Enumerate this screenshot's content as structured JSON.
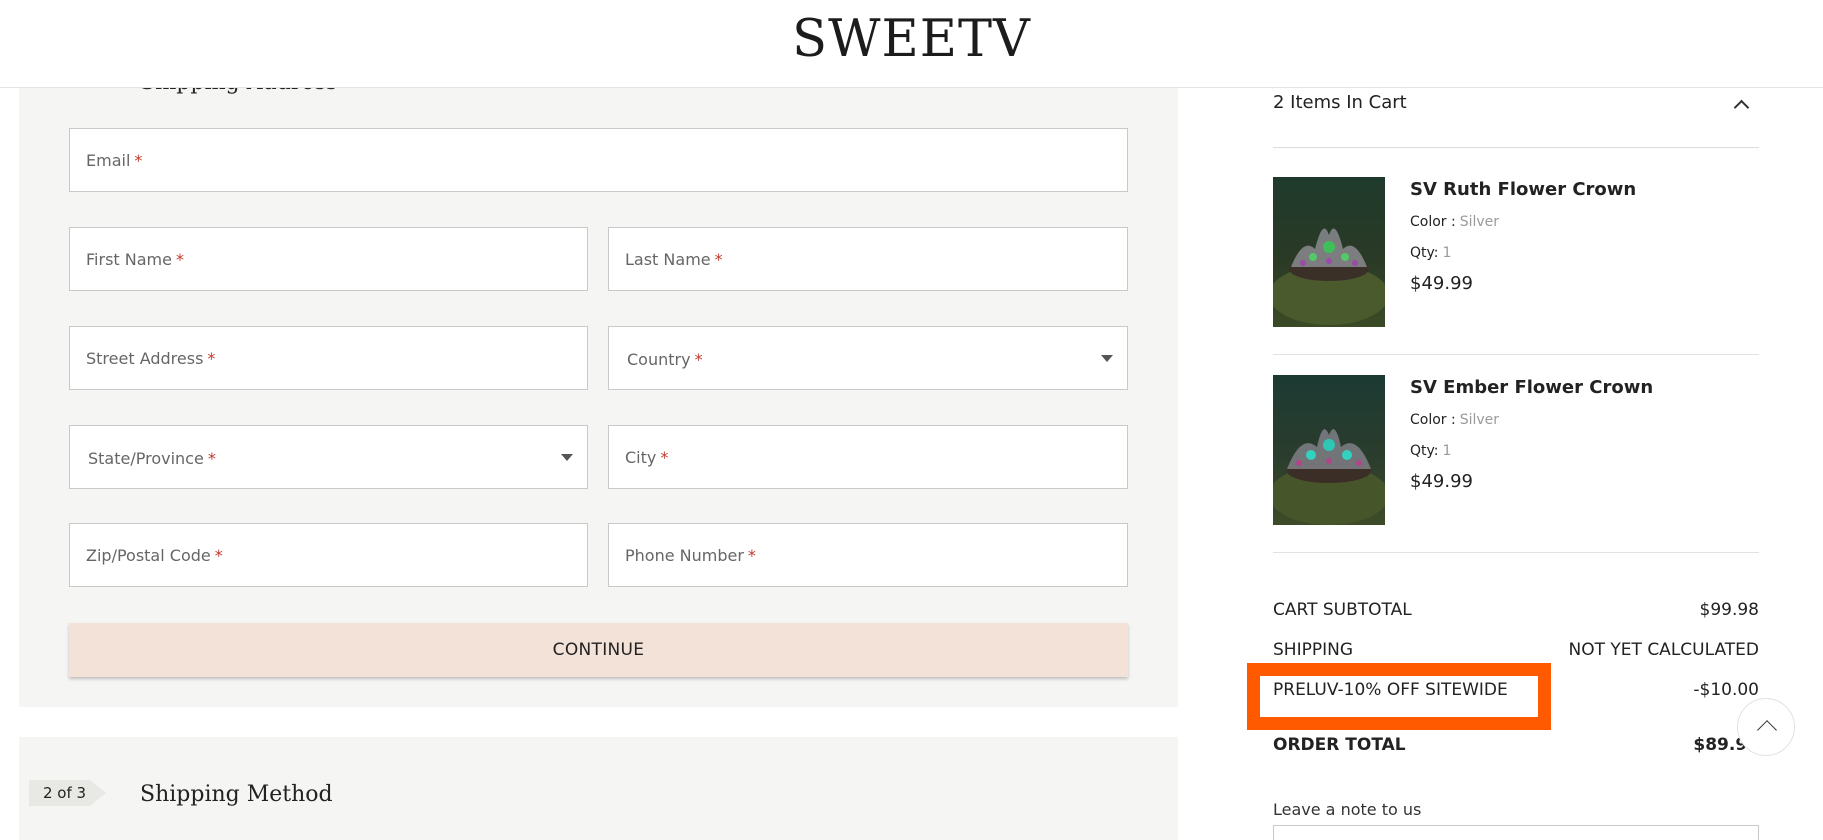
{
  "brand": {
    "logo": "SWEETV"
  },
  "checkout": {
    "step1": {
      "badge": "",
      "title": "Shipping Address"
    },
    "step2": {
      "badge": "2 of 3",
      "title": "Shipping Method"
    },
    "fields": {
      "email": "Email",
      "first_name": "First Name",
      "last_name": "Last Name",
      "street": "Street Address",
      "country": "Country",
      "state": "State/Province",
      "city": "City",
      "zip": "Zip/Postal Code",
      "phone": "Phone Number",
      "required_mark": "*"
    },
    "continue_label": "CONTINUE"
  },
  "cart": {
    "count_label": "2 Items In Cart",
    "items": [
      {
        "name": "SV Ruth Flower Crown",
        "color_label": "Color :",
        "color": "Silver",
        "qty_label": "Qty:",
        "qty": "1",
        "price": "$49.99"
      },
      {
        "name": "SV Ember Flower Crown",
        "color_label": "Color :",
        "color": "Silver",
        "qty_label": "Qty:",
        "qty": "1",
        "price": "$49.99"
      }
    ],
    "summary": {
      "subtotal_label": "CART SUBTOTAL",
      "subtotal": "$99.98",
      "shipping_label": "SHIPPING",
      "shipping": "NOT YET CALCULATED",
      "discount_label": "PRELUV-10% OFF SITEWIDE",
      "discount": "-$10.00",
      "total_label": "ORDER TOTAL",
      "total": "$89.98"
    },
    "note_label": "Leave a note to us"
  },
  "colors": {
    "accent": "#f3e2d8",
    "highlight": "#ff5a00",
    "required": "#c0392b"
  }
}
